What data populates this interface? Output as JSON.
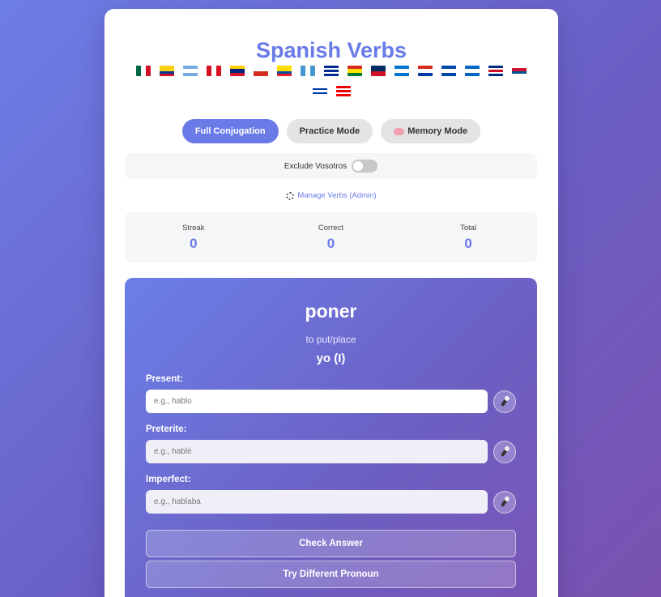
{
  "app": {
    "title": "Spanish Verbs"
  },
  "flags": [
    {
      "name": "mexico",
      "dir": "vert",
      "colors": [
        "#006847",
        "#ffffff",
        "#ce1126"
      ]
    },
    {
      "name": "colombia",
      "dir": "horiz",
      "colors": [
        "#fcd116",
        "#fcd116",
        "#003893",
        "#ce1126"
      ]
    },
    {
      "name": "argentina",
      "dir": "horiz",
      "colors": [
        "#74acdf",
        "#ffffff",
        "#74acdf"
      ]
    },
    {
      "name": "peru",
      "dir": "vert",
      "colors": [
        "#d91023",
        "#ffffff",
        "#d91023"
      ]
    },
    {
      "name": "venezuela",
      "dir": "horiz",
      "colors": [
        "#ffcc00",
        "#00247d",
        "#cf142b"
      ]
    },
    {
      "name": "chile",
      "dir": "horiz",
      "colors": [
        "#ffffff",
        "#d52b1e"
      ]
    },
    {
      "name": "ecuador",
      "dir": "horiz",
      "colors": [
        "#ffdd00",
        "#ffdd00",
        "#034ea2",
        "#ed1c24"
      ]
    },
    {
      "name": "guatemala",
      "dir": "vert",
      "colors": [
        "#4997d0",
        "#ffffff",
        "#4997d0"
      ]
    },
    {
      "name": "cuba",
      "dir": "horiz",
      "colors": [
        "#002a8f",
        "#ffffff",
        "#002a8f",
        "#ffffff",
        "#002a8f"
      ]
    },
    {
      "name": "bolivia",
      "dir": "horiz",
      "colors": [
        "#d52b1e",
        "#f9e300",
        "#007934"
      ]
    },
    {
      "name": "dominican-republic",
      "dir": "horiz",
      "colors": [
        "#002d62",
        "#ce1126"
      ]
    },
    {
      "name": "honduras",
      "dir": "horiz",
      "colors": [
        "#0073cf",
        "#ffffff",
        "#0073cf"
      ]
    },
    {
      "name": "paraguay",
      "dir": "horiz",
      "colors": [
        "#d52b1e",
        "#ffffff",
        "#0038a8"
      ]
    },
    {
      "name": "el-salvador",
      "dir": "horiz",
      "colors": [
        "#0047ab",
        "#ffffff",
        "#0047ab"
      ]
    },
    {
      "name": "nicaragua",
      "dir": "horiz",
      "colors": [
        "#0067c6",
        "#ffffff",
        "#0067c6"
      ]
    },
    {
      "name": "costa-rica",
      "dir": "horiz",
      "colors": [
        "#002b7f",
        "#ffffff",
        "#ce1126",
        "#ffffff",
        "#002b7f"
      ]
    },
    {
      "name": "panama",
      "dir": "horiz",
      "colors": [
        "#ffffff",
        "#d21034",
        "#005293",
        "#ffffff"
      ]
    },
    {
      "name": "uruguay",
      "dir": "horiz",
      "colors": [
        "#ffffff",
        "#0038a8",
        "#ffffff",
        "#0038a8",
        "#ffffff"
      ]
    },
    {
      "name": "puerto-rico",
      "dir": "horiz",
      "colors": [
        "#ed0000",
        "#ffffff",
        "#ed0000",
        "#ffffff",
        "#ed0000"
      ]
    }
  ],
  "modes": {
    "full": "Full Conjugation",
    "practice": "Practice Mode",
    "memory": "Memory Mode"
  },
  "settings": {
    "exclude_vosotros": "Exclude Vosotros",
    "exclude_vosotros_on": false
  },
  "admin": {
    "label": "Manage Verbs (Admin)",
    "icon": "gear-icon"
  },
  "stats": {
    "streak_label": "Streak",
    "streak": "0",
    "correct_label": "Correct",
    "correct": "0",
    "total_label": "Total",
    "total": "0"
  },
  "quiz": {
    "verb": "poner",
    "translation": "to put/place",
    "pronoun": "yo (I)",
    "present_label": "Present:",
    "present_placeholder": "e.g., hablo",
    "preterite_label": "Preterite:",
    "preterite_placeholder": "e.g., hablé",
    "imperfect_label": "Imperfect:",
    "imperfect_placeholder": "e.g., hablaba",
    "check": "Check Answer",
    "different": "Try Different Pronoun"
  },
  "colors": {
    "accent": "#6a7be8",
    "card": "#ffffff"
  }
}
